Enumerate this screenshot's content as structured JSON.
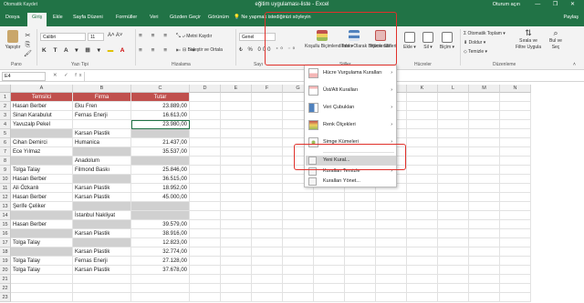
{
  "titlebar": {
    "quick_access": "Otomatik Kaydet",
    "title": "eğitim uygulaması-liste - Excel",
    "user": "Oturum açın",
    "window_controls": "— ❐ ✕"
  },
  "menubar": {
    "tabs": [
      "Dosya",
      "Giriş",
      "Ekle",
      "Sayfa Düzeni",
      "Formüller",
      "Veri",
      "Gözden Geçir",
      "Görünüm"
    ],
    "active_tab": "Giriş",
    "tell_me": "Ne yapmak istediğinizi söyleyin",
    "share": "Paylaş"
  },
  "ribbon": {
    "paste": "Yapıştır",
    "clipboard": "Pano",
    "font_name": "Calibri",
    "font_size": "11",
    "font_group": "Yazı Tipi",
    "wrap_text": "Metni Kaydır",
    "merge_center": "Birleştir ve Ortala",
    "alignment_group": "Hizalama",
    "number_format": "Genel",
    "number_group": "Sayı",
    "conditional_formatting": "Koşullu Biçimlendirme",
    "format_as_table": "Tablo Olarak Biçimlendir",
    "cell_styles": "Hücre Stilleri",
    "styles_group": "Stiller",
    "insert": "Ekle",
    "delete": "Sil",
    "format": "Biçim",
    "cells_group": "Hücreler",
    "autosum": "Otomatik Toplam",
    "fill": "Doldur",
    "clear": "Temizle",
    "sort_filter": "Sırala ve Filtre Uygula",
    "find_select": "Bul ve Seç",
    "editing_group": "Düzenleme"
  },
  "formula_bar": {
    "name_box": "E4",
    "fx": "✕ ✓ fx",
    "value": ""
  },
  "columns": [
    "A",
    "B",
    "C",
    "D",
    "E",
    "F",
    "G",
    "H",
    "I",
    "J",
    "K",
    "L",
    "M",
    "N"
  ],
  "table": {
    "headers": [
      "Temsilci",
      "Firma",
      "Tutar"
    ],
    "rows": [
      {
        "n": "2",
        "a": "Hasan Berber",
        "b": "Eku Fren",
        "c": "23.889,00",
        "gray": []
      },
      {
        "n": "3",
        "a": "Sinan Karabulut",
        "b": "Fernas Enerji",
        "c": "16.613,00",
        "gray": []
      },
      {
        "n": "4",
        "a": "Yavuzalp Pekel",
        "b": "",
        "c": "23.980,00",
        "gray": []
      },
      {
        "n": "5",
        "a": "",
        "b": "Karsan Plastik",
        "c": "",
        "gray": [
          "a",
          "c"
        ]
      },
      {
        "n": "6",
        "a": "Cihan Demirci",
        "b": "Humanica",
        "c": "21.437,00",
        "gray": []
      },
      {
        "n": "7",
        "a": "Ece Yılmaz",
        "b": "",
        "c": "35.537,00",
        "gray": [
          "b"
        ]
      },
      {
        "n": "8",
        "a": "",
        "b": "Anadolum",
        "c": "",
        "gray": [
          "a",
          "c"
        ]
      },
      {
        "n": "9",
        "a": "Tolga Talay",
        "b": "Filmond Baskı",
        "c": "25.846,00",
        "gray": []
      },
      {
        "n": "10",
        "a": "Hasan Berber",
        "b": "",
        "c": "36.515,00",
        "gray": [
          "b"
        ]
      },
      {
        "n": "11",
        "a": "Ali Özkanlı",
        "b": "Karsan Plastik",
        "c": "18.952,00",
        "gray": []
      },
      {
        "n": "12",
        "a": "Hasan Berber",
        "b": "Karsan Plastik",
        "c": "45.000,00",
        "gray": []
      },
      {
        "n": "13",
        "a": "Şerife Çeliker",
        "b": "",
        "c": "",
        "gray": [
          "b",
          "c"
        ]
      },
      {
        "n": "14",
        "a": "",
        "b": "İstanbul Nakliyat",
        "c": "",
        "gray": [
          "a",
          "c"
        ]
      },
      {
        "n": "15",
        "a": "Hasan Berber",
        "b": "",
        "c": "39.579,00",
        "gray": [
          "b"
        ]
      },
      {
        "n": "16",
        "a": "",
        "b": "Karsan Plastik",
        "c": "38.916,00",
        "gray": [
          "a"
        ]
      },
      {
        "n": "17",
        "a": "Tolga Talay",
        "b": "",
        "c": "12.823,00",
        "gray": [
          "b"
        ]
      },
      {
        "n": "18",
        "a": "",
        "b": "Karsan Plastik",
        "c": "32.774,00",
        "gray": [
          "a"
        ]
      },
      {
        "n": "19",
        "a": "Tolga Talay",
        "b": "Fernas Enerji",
        "c": "27.128,00",
        "gray": []
      },
      {
        "n": "20",
        "a": "Tolga Talay",
        "b": "Karsan Plastik",
        "c": "37.678,00",
        "gray": []
      }
    ]
  },
  "menu": {
    "items": [
      "Hücre Vurgulama Kuralları",
      "Üst/Alt Kuralları",
      "Veri Çubukları",
      "Renk Ölçekleri",
      "Simge Kümeleri",
      "Yeni Kural...",
      "Kuralları Temizle",
      "Kuralları Yönet..."
    ]
  },
  "colors": {
    "excel_green": "#217346",
    "header_red": "#c0504d",
    "highlight_red": "#e0302a",
    "gray_fill": "#d0d0d0"
  }
}
